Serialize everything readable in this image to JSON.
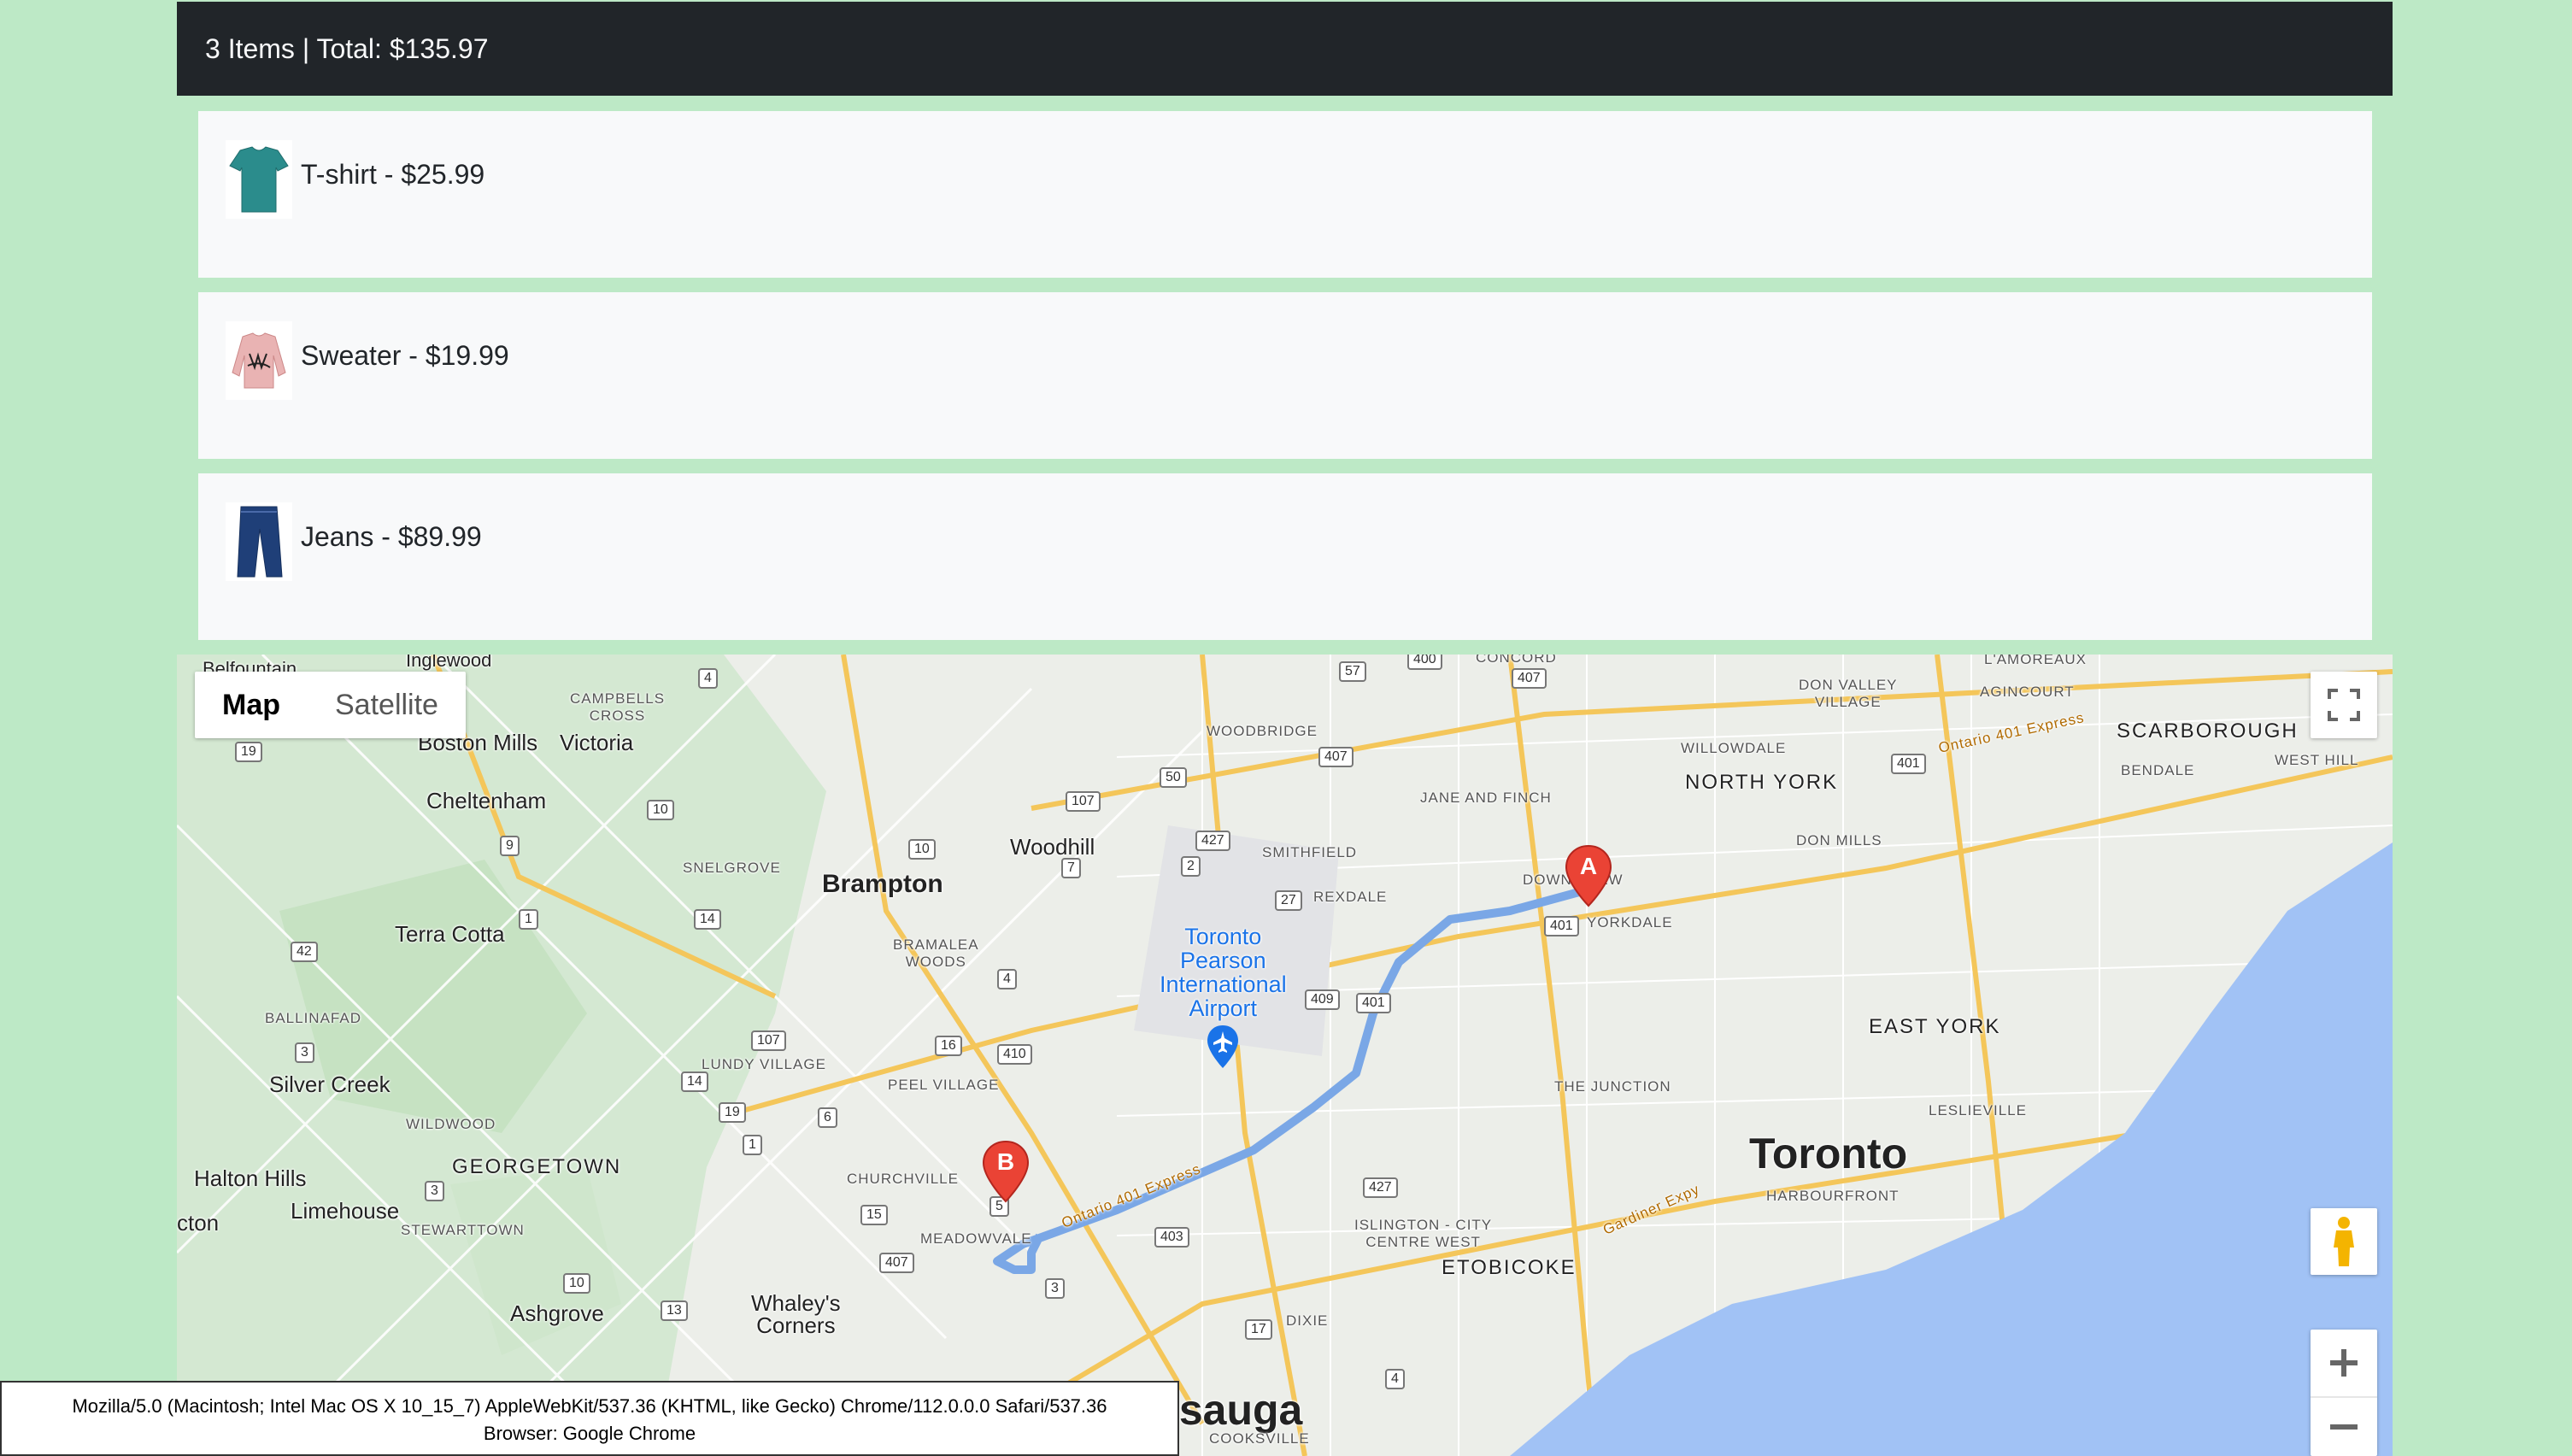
{
  "cart": {
    "summary": "3 Items | Total: $135.97",
    "items": [
      {
        "label": "T-shirt - $25.99",
        "image": "tshirt-image"
      },
      {
        "label": "Sweater - $19.99",
        "image": "sweater-image"
      },
      {
        "label": "Jeans - $89.99",
        "image": "jeans-image"
      }
    ]
  },
  "map": {
    "type_control": {
      "map_label": "Map",
      "satellite_label": "Satellite",
      "selected": "Map"
    },
    "markers": {
      "a": "A",
      "b": "B"
    },
    "labels": {
      "toronto": "Toronto",
      "mississauga": "Mississauga",
      "brampton": "Brampton",
      "north_york": "NORTH YORK",
      "scarborough": "SCARBOROUGH",
      "east_york": "EAST YORK",
      "etobicoke": "ETOBICOKE",
      "airport": "Toronto\nPearson\nInternational\nAirport",
      "woodhill": "Woodhill",
      "terra_cotta": "Terra Cotta",
      "cheltenham": "Cheltenham",
      "silver_creek": "Silver Creek",
      "georgetown": "GEORGETOWN",
      "halton_hills": "Halton Hills",
      "limehouse": "Limehouse",
      "ashgrove": "Ashgrove",
      "whaleys_corners": "Whaley's\nCorners",
      "victoria": "Victoria",
      "boston_mills": "Boston Mills",
      "campbells_cross": "CAMPBELLS\nCROSS",
      "snelgrove": "SNELGROVE",
      "bramalea_woods": "BRAMALEA\nWOODS",
      "lundy_village": "LUNDY VILLAGE",
      "peel_village": "PEEL VILLAGE",
      "churchville": "CHURCHVILLE",
      "meadowvale": "MEADOWVALE",
      "woodbridge": "WOODBRIDGE",
      "smithfield": "SMITHFIELD",
      "rexdale": "REXDALE",
      "jane_and_finch": "JANE AND FINCH",
      "downsview": "DOWNSVIEW",
      "yorkdale": "YORKDALE",
      "willowdale": "WILLOWDALE",
      "don_valley_village": "DON VALLEY\nVILLAGE",
      "agincourt": "AGINCOURT",
      "lamoureaux": "L'AMOREAUX",
      "bendale": "BENDALE",
      "west_hill": "WEST HILL",
      "don_mills": "DON MILLS",
      "the_junction": "THE JUNCTION",
      "leslieville": "LESLIEVILLE",
      "harbourfront": "HARBOURFRONT",
      "islington": "ISLINGTON - CITY\nCENTRE WEST",
      "dixie": "DIXIE",
      "cooksville": "COOKSVILLE",
      "wildwood": "WILDWOOD",
      "ballinafad": "BALLINAFAD",
      "stewarttown": "STEWARTTOWN",
      "concord": "CONCORD",
      "inglewood": "Inglewood",
      "belfountain": "Belfountain",
      "acton": "cton",
      "ontario_401_express": "Ontario 401 Express",
      "gardiner": "Gardiner Expy"
    },
    "shields": [
      "4",
      "14",
      "57",
      "400",
      "407",
      "19",
      "10",
      "9",
      "1",
      "42",
      "3",
      "107",
      "10",
      "7",
      "427",
      "2",
      "27",
      "4",
      "410",
      "16",
      "107",
      "6",
      "1",
      "15",
      "5",
      "407",
      "3",
      "403",
      "17",
      "427",
      "409",
      "401",
      "401",
      "401",
      "407",
      "50",
      "14",
      "19",
      "13",
      "10",
      "3",
      "4"
    ]
  },
  "user_agent": {
    "line1": "Mozilla/5.0 (Macintosh; Intel Mac OS X 10_15_7) AppleWebKit/537.36 (KHTML, like Gecko) Chrome/112.0.0.0 Safari/537.36",
    "line2": "Browser: Google Chrome"
  },
  "colors": {
    "topbar": "#212529",
    "page_bg": "#bde9c6",
    "card_bg": "#f8f9fa",
    "water": "#a1c2f5",
    "marker": "#ea4335",
    "route": "#7aa7e6"
  }
}
